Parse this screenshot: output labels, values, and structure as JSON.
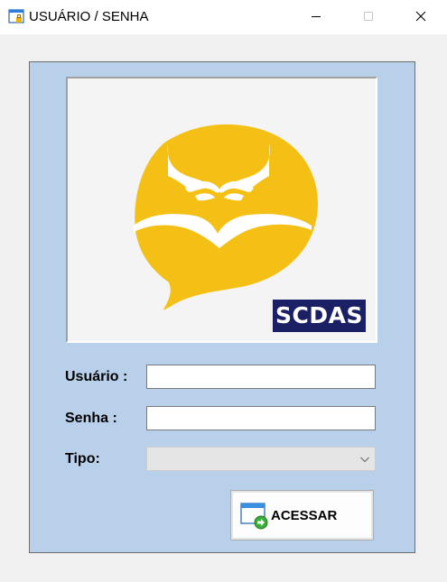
{
  "window": {
    "title": "USUÁRIO / SENHA"
  },
  "logo": {
    "badge_text": "SCDAS",
    "accent_color": "#f5c015",
    "badge_color": "#1b1f63"
  },
  "form": {
    "user_label": "Usuário :",
    "user_value": "",
    "password_label": "Senha :",
    "password_value": "",
    "type_label": "Tipo:",
    "type_value": ""
  },
  "actions": {
    "submit_label": "ACESSAR"
  },
  "colors": {
    "panel_bg": "#b8d0ea",
    "window_bg": "#f0f0f0"
  }
}
